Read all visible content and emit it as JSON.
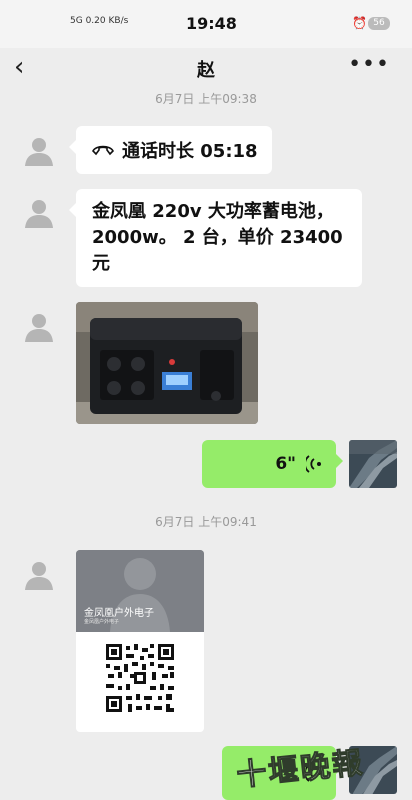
{
  "status_bar": {
    "network": "5G",
    "speed": "0.20",
    "speed_unit": "KB/s",
    "time": "19:48",
    "battery": "56"
  },
  "header": {
    "title": "赵"
  },
  "messages": {
    "timestamp_1": "6月7日 上午09:38",
    "call_record": "通话时长 05:18",
    "text_message": "金凤凰 220v 大功率蓄电池，2000w。 2 台，单价 23400 元",
    "voice_duration": "6\"",
    "timestamp_2": "6月7日 上午09:41",
    "card_name": "金凤凰户外电子",
    "card_subtitle": "金凤凰户外电子"
  },
  "watermark": "十堰晚報"
}
